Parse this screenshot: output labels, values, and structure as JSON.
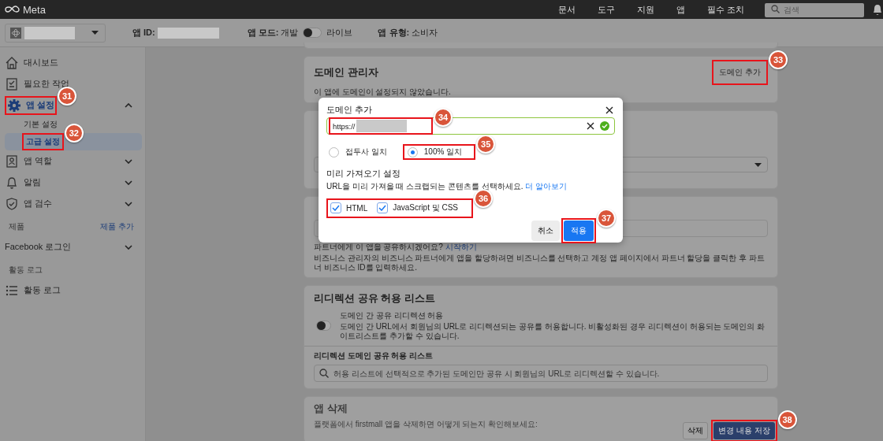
{
  "topbar": {
    "logo": "Meta",
    "nav": [
      "문서",
      "도구",
      "지원",
      "앱",
      "필수 조치"
    ],
    "search": {
      "placeholder": "검색"
    }
  },
  "app_header": {
    "app_id_label": "앱 ID:",
    "mode_label": "앱 모드:",
    "mode_value": "개발",
    "live_label": "라이브",
    "live_on": false,
    "type_label": "앱 유형:",
    "type_value": "소비자"
  },
  "sidebar": {
    "items": [
      {
        "kind": "item",
        "label": "대시보드",
        "selected": false
      },
      {
        "kind": "item",
        "label": "필요한 작업",
        "selected": false
      },
      {
        "kind": "item",
        "label": "앱 설정",
        "selected": true,
        "expanded": true,
        "callout": "31",
        "children": [
          {
            "label": "기본 설정",
            "selected": false
          },
          {
            "label": "고급 설정",
            "selected": true,
            "callout": "32"
          }
        ]
      },
      {
        "kind": "item",
        "label": "앱 역할",
        "selected": false,
        "expanded": false
      },
      {
        "kind": "item",
        "label": "알림",
        "selected": false,
        "expanded": false
      },
      {
        "kind": "item",
        "label": "앱 검수",
        "selected": false,
        "expanded": false
      },
      {
        "kind": "section",
        "label": "제품",
        "link": "제품 추가"
      },
      {
        "kind": "item",
        "label": "Facebook 로그인",
        "selected": false,
        "expanded": false
      },
      {
        "kind": "section",
        "label": "활동 로그"
      },
      {
        "kind": "item",
        "label": "활동 로그",
        "selected": false
      }
    ]
  },
  "domain_manager": {
    "title": "도메인 관리자",
    "add_button": {
      "label": "도메인 추가",
      "callout": "33"
    },
    "message": "이 앱에 도메인이 설정되지 않았습니다."
  },
  "partner": {
    "question": "파트너에게 이 앱을 공유하시겠어요?",
    "link": "시작하기",
    "help": "비즈니스 관리자의 비즈니스 파트너에게 앱을 할당하려면 비즈니스를 선택하고 계정 앱 페이지에서 파트너 할당을 클릭한 후 파트너 비즈니스 ID를 입력하세요."
  },
  "redirect": {
    "title": "리디렉션 공유 허용 리스트",
    "toggle": {
      "label": "도메인 간 공유 리디렉션 허용",
      "description": "도메인 간 URL에서 회원님의 URL로 리디렉션되는 공유를 허용합니다. 비활성화된 경우 리디렉션이 허용되는 도메인의 화이트리스트를 추가할 수 있습니다.",
      "on": false
    },
    "list_label": "리디렉션 도메인 공유 허용 리스트",
    "search": {
      "placeholder": "허용 리스트에 선택적으로 추가된 도메인만 공유 시 회원님의 URL로 리디렉션할 수 있습니다."
    }
  },
  "delete_app": {
    "title": "앱 삭제",
    "description": "플랫폼에서 firstmall 앱을 삭제하면 어떻게 되는지 확인해보세요:"
  },
  "action_bar": {
    "delete": "삭제",
    "save": {
      "label": "변경 내용 저장",
      "callout": "38"
    }
  },
  "dialog": {
    "title": "도메인 추가",
    "url": {
      "value": "https://",
      "valid": true,
      "callout": "34"
    },
    "match": [
      {
        "label": "접두사 일치",
        "selected": false
      },
      {
        "label": "100% 일치",
        "selected": true,
        "callout": "35"
      }
    ],
    "preview": {
      "title": "미리 가져오기 설정",
      "description": "URL을 미리 가져올 때 스크랩되는 콘텐츠를 선택하세요.",
      "link": "더 알아보기",
      "callout": "36",
      "options": [
        {
          "label": "HTML",
          "checked": true
        },
        {
          "label": "JavaScript 및 CSS",
          "checked": true
        }
      ]
    },
    "buttons": [
      {
        "label": "취소",
        "kind": "secondary"
      },
      {
        "label": "적용",
        "kind": "primary",
        "callout": "37"
      }
    ]
  }
}
